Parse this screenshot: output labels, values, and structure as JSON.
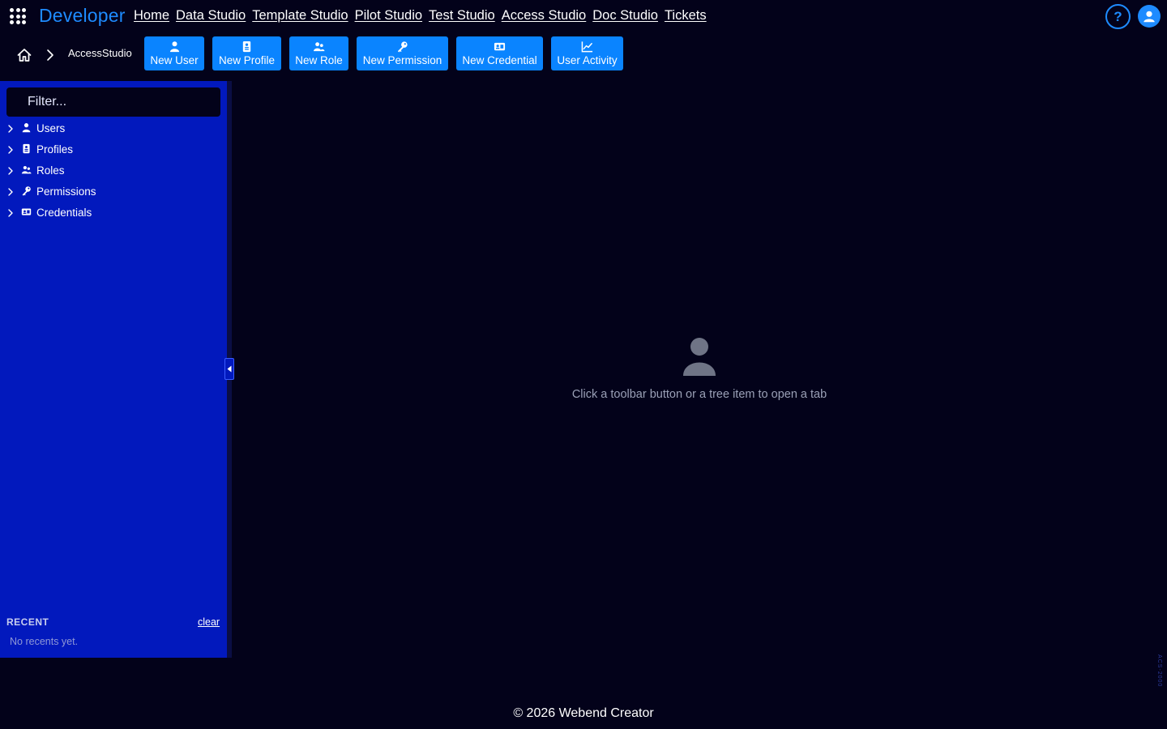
{
  "header": {
    "brand": "Developer",
    "nav": [
      {
        "label": "Home"
      },
      {
        "label": "Data Studio"
      },
      {
        "label": "Template Studio"
      },
      {
        "label": "Pilot Studio"
      },
      {
        "label": "Test Studio"
      },
      {
        "label": "Access Studio"
      },
      {
        "label": "Doc Studio"
      },
      {
        "label": "Tickets"
      }
    ],
    "help_label": "?"
  },
  "breadcrumb": {
    "current": "AccessStudio"
  },
  "toolbar": {
    "buttons": [
      {
        "label": "New User",
        "icon": "user-icon"
      },
      {
        "label": "New Profile",
        "icon": "profile-icon"
      },
      {
        "label": "New Role",
        "icon": "role-icon"
      },
      {
        "label": "New Permission",
        "icon": "key-icon"
      },
      {
        "label": "New Credential",
        "icon": "credential-icon"
      },
      {
        "label": "User Activity",
        "icon": "chart-line-icon"
      }
    ]
  },
  "sidebar": {
    "filter_placeholder": "Filter...",
    "tree": [
      {
        "label": "Users",
        "icon": "user-icon"
      },
      {
        "label": "Profiles",
        "icon": "profile-icon"
      },
      {
        "label": "Roles",
        "icon": "role-icon"
      },
      {
        "label": "Permissions",
        "icon": "key-icon"
      },
      {
        "label": "Credentials",
        "icon": "credential-icon"
      }
    ],
    "recent": {
      "title": "RECENT",
      "clear_label": "clear",
      "empty_text": "No recents yet."
    }
  },
  "main": {
    "empty_text": "Click a toolbar button or a tree item to open a tab"
  },
  "version_tag": "ACS-2000",
  "footer": {
    "text": "© 2026 Webend Creator"
  },
  "colors": {
    "background": "#03021a",
    "accent": "#1e8bff",
    "button": "#0a84ff",
    "sidebar": "#0219bd"
  }
}
